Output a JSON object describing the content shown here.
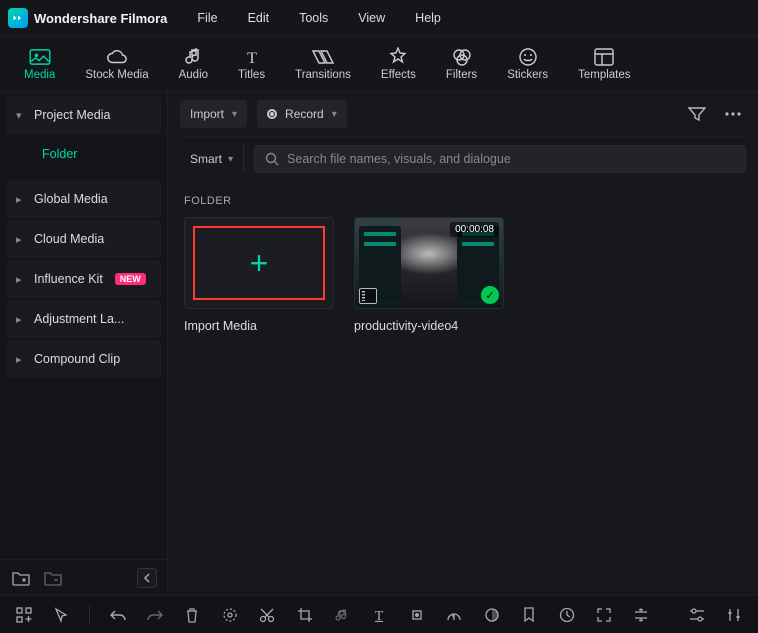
{
  "app": {
    "name": "Wondershare Filmora"
  },
  "menu": {
    "file": "File",
    "edit": "Edit",
    "tools": "Tools",
    "view": "View",
    "help": "Help"
  },
  "tooltabs": {
    "media": "Media",
    "stock_media": "Stock Media",
    "audio": "Audio",
    "titles": "Titles",
    "transitions": "Transitions",
    "effects": "Effects",
    "filters": "Filters",
    "stickers": "Stickers",
    "templates": "Templates"
  },
  "sidebar": {
    "items": [
      {
        "label": "Project Media",
        "expanded": true
      },
      {
        "label": "Folder",
        "sub": true
      },
      {
        "label": "Global Media"
      },
      {
        "label": "Cloud Media"
      },
      {
        "label": "Influence Kit",
        "badge": "NEW"
      },
      {
        "label": "Adjustment La..."
      },
      {
        "label": "Compound Clip"
      }
    ]
  },
  "toolbar": {
    "import_label": "Import",
    "record_label": "Record"
  },
  "search": {
    "smart": "Smart",
    "placeholder": "Search file names, visuals, and dialogue"
  },
  "section": {
    "heading": "FOLDER"
  },
  "cards": {
    "import": {
      "label": "Import Media"
    },
    "video": {
      "label": "productivity-video4",
      "duration": "00:00:08"
    }
  }
}
